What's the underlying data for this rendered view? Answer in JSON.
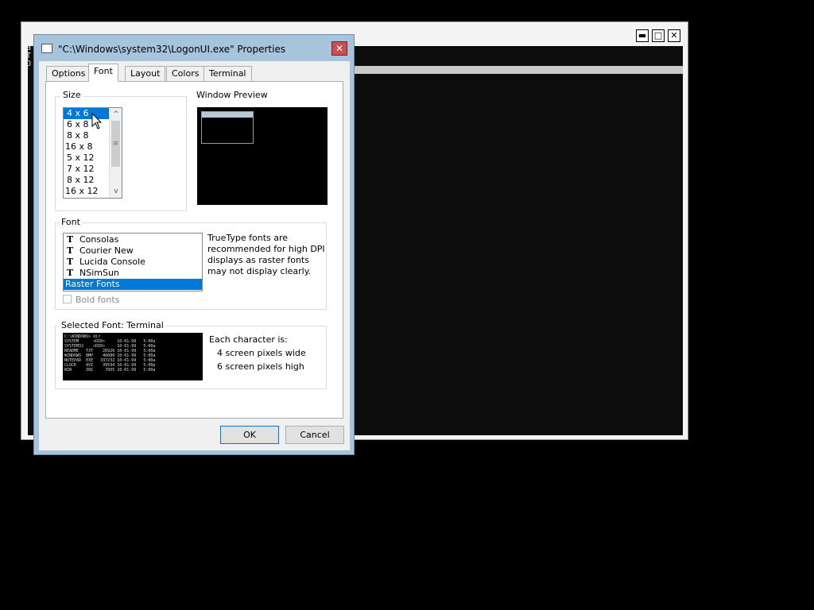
{
  "background_window": {
    "controls": {
      "minimize": "▬",
      "maximize": "□",
      "close": "✕"
    },
    "side_text": [
      "a",
      "T",
      "O"
    ]
  },
  "dialog": {
    "title": "\"C:\\Windows\\system32\\LogonUI.exe\" Properties",
    "tabs": [
      {
        "label": "Options",
        "active": false
      },
      {
        "label": "Font",
        "active": true
      },
      {
        "label": "Layout",
        "active": false
      },
      {
        "label": "Colors",
        "active": false
      },
      {
        "label": "Terminal",
        "active": false
      }
    ],
    "size_group": {
      "label": "Size",
      "items": [
        "4 x 6",
        "6 x 8",
        "8 x 8",
        "16 x 8",
        "5 x 12",
        "7 x 12",
        "8 x 12",
        "16 x 12"
      ],
      "selected": "4 x 6"
    },
    "window_preview": {
      "label": "Window Preview"
    },
    "font_group": {
      "label": "Font",
      "items": [
        {
          "name": "Consolas",
          "truetype": true
        },
        {
          "name": "Courier New",
          "truetype": true
        },
        {
          "name": "Lucida Console",
          "truetype": true
        },
        {
          "name": "NSimSun",
          "truetype": true
        },
        {
          "name": "Raster Fonts",
          "truetype": false
        }
      ],
      "selected": "Raster Fonts",
      "note": "TrueType fonts are recommended for high DPI displays as raster fonts may not display clearly.",
      "bold_label": "Bold fonts"
    },
    "selected_font": {
      "label": "Selected Font: Terminal",
      "sample_lines": [
        "C:\\WINDOWS> dir",
        "SYSTEM      <DIR>     10-01-99   5:00a",
        "SYSTEM32    <DIR>     10-01-99   5:00a",
        "README   TXT    26926 10-01-99   5:00a",
        "WINDOWS  BMP    46080 10-01-99   5:00a",
        "NOTEPAD  EXE   337232 10-01-99   5:00a",
        "CLOCK    AVI    39594 10-01-99   5:00p",
        "WIN      INI     7005 10-01-99   5:00a"
      ],
      "char_heading": "Each character is:",
      "width_line": "4 screen pixels wide",
      "height_line": "6 screen pixels high"
    },
    "buttons": {
      "ok": "OK",
      "cancel": "Cancel"
    },
    "close_glyph": "✕"
  },
  "icons": {
    "scroll_up": "^",
    "scroll_down": "v",
    "scroll_grip": "≡",
    "truetype": "T"
  }
}
